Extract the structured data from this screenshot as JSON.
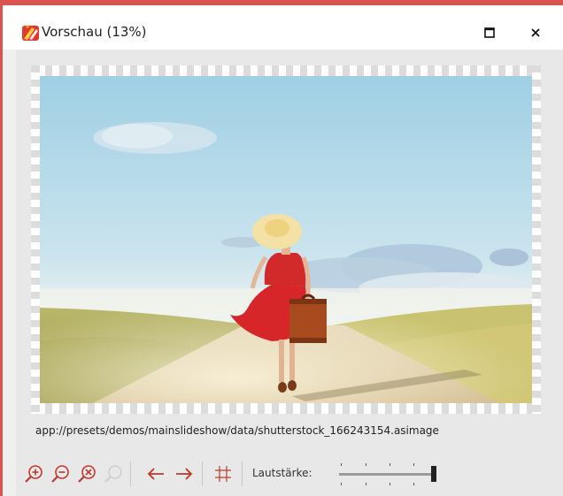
{
  "window": {
    "title": "Vorschau (13%)",
    "maximize_icon": "maximize-icon",
    "close_icon": "close-icon",
    "accent_color": "#d9534f"
  },
  "preview": {
    "image_description": "photo",
    "file_path": "app://presets/demos/mainslideshow/data/shutterstock_166243154.asimage"
  },
  "toolbar": {
    "icons": [
      "zoom-in-icon",
      "zoom-out-icon",
      "zoom-reset-icon",
      "zoom-fit-icon",
      "arrow-left-icon",
      "arrow-right-icon",
      "grid-icon"
    ],
    "volume_label": "Lautstärke:",
    "volume_level": 1.0
  }
}
